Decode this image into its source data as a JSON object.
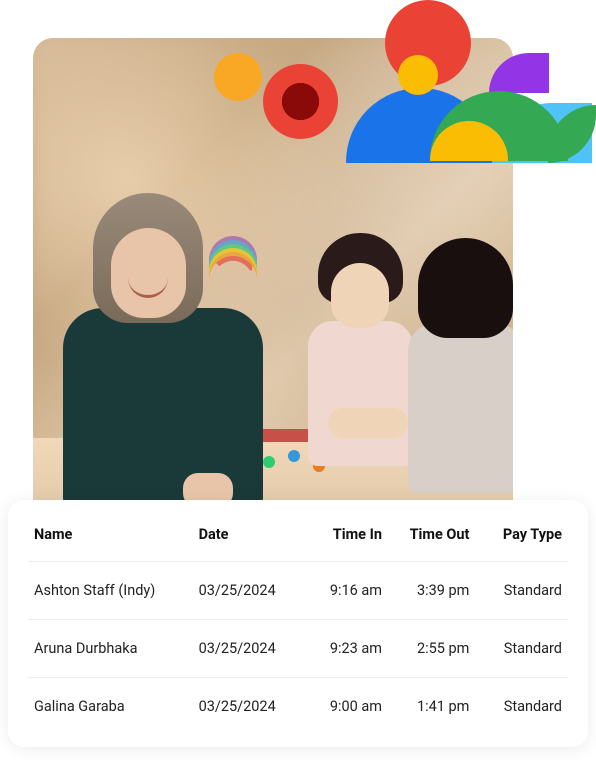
{
  "table": {
    "headers": {
      "name": "Name",
      "date": "Date",
      "time_in": "Time In",
      "time_out": "Time Out",
      "pay_type": "Pay Type"
    },
    "rows": [
      {
        "name": "Ashton Staff (Indy)",
        "date": "03/25/2024",
        "time_in": "9:16 am",
        "time_out": "3:39 pm",
        "pay_type": "Standard"
      },
      {
        "name": "Aruna Durbhaka",
        "date": "03/25/2024",
        "time_in": "9:23 am",
        "time_out": "2:55 pm",
        "pay_type": "Standard"
      },
      {
        "name": "Galina Garaba",
        "date": "03/25/2024",
        "time_in": "9:00 am",
        "time_out": "1:41 pm",
        "pay_type": "Standard"
      }
    ]
  }
}
